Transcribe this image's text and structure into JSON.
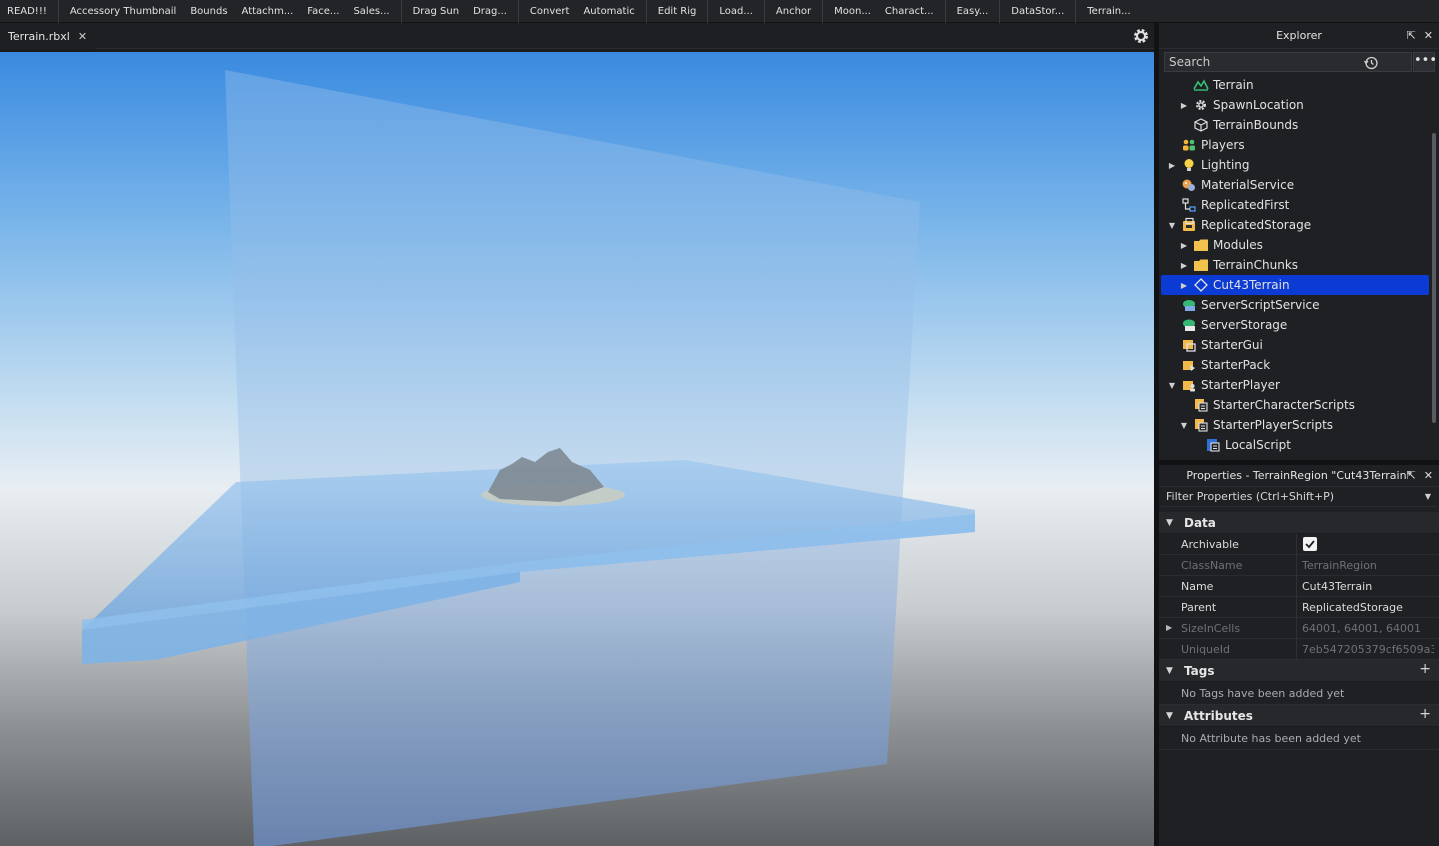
{
  "toolbar": {
    "buttons": [
      "READ!!!",
      "Accessory Thumbnail",
      "Bounds",
      "Attachm...",
      "Face...",
      "Sales...",
      "Drag Sun",
      "Drag...",
      "Convert",
      "Automatic",
      "Edit Rig",
      "Load...",
      "Anchor",
      "Moon...",
      "Charact...",
      "Easy...",
      "DataStor...",
      "Terrain..."
    ]
  },
  "tabs": [
    {
      "label": "Terrain.rbxl",
      "close_icon": "close-icon"
    }
  ],
  "explorer": {
    "title": "Explorer",
    "search_placeholder": "Search",
    "more_label": "•••",
    "items": [
      {
        "label": "Terrain",
        "depth": 1,
        "expander": "none",
        "icon": "terrain-icon"
      },
      {
        "label": "SpawnLocation",
        "depth": 1,
        "expander": "collapsed",
        "icon": "spawn-location-icon"
      },
      {
        "label": "TerrainBounds",
        "depth": 1,
        "expander": "none",
        "icon": "part-icon"
      },
      {
        "label": "Players",
        "depth": 0,
        "expander": "none",
        "icon": "players-icon"
      },
      {
        "label": "Lighting",
        "depth": 0,
        "expander": "collapsed",
        "icon": "lighting-icon"
      },
      {
        "label": "MaterialService",
        "depth": 0,
        "expander": "none",
        "icon": "material-service-icon"
      },
      {
        "label": "ReplicatedFirst",
        "depth": 0,
        "expander": "none",
        "icon": "replicated-first-icon"
      },
      {
        "label": "ReplicatedStorage",
        "depth": 0,
        "expander": "expanded",
        "icon": "replicated-storage-icon"
      },
      {
        "label": "Modules",
        "depth": 1,
        "expander": "collapsed",
        "icon": "folder-icon"
      },
      {
        "label": "TerrainChunks",
        "depth": 1,
        "expander": "collapsed",
        "icon": "folder-icon"
      },
      {
        "label": "Cut43Terrain",
        "depth": 1,
        "expander": "collapsed",
        "icon": "terrain-region-icon",
        "selected": true
      },
      {
        "label": "ServerScriptService",
        "depth": 0,
        "expander": "none",
        "icon": "server-script-service-icon"
      },
      {
        "label": "ServerStorage",
        "depth": 0,
        "expander": "none",
        "icon": "server-storage-icon"
      },
      {
        "label": "StarterGui",
        "depth": 0,
        "expander": "none",
        "icon": "starter-gui-icon"
      },
      {
        "label": "StarterPack",
        "depth": 0,
        "expander": "none",
        "icon": "starter-pack-icon"
      },
      {
        "label": "StarterPlayer",
        "depth": 0,
        "expander": "expanded",
        "icon": "starter-player-icon"
      },
      {
        "label": "StarterCharacterScripts",
        "depth": 1,
        "expander": "none",
        "icon": "starter-scripts-icon"
      },
      {
        "label": "StarterPlayerScripts",
        "depth": 1,
        "expander": "expanded",
        "icon": "starter-scripts-icon"
      },
      {
        "label": "LocalScript",
        "depth": 2,
        "expander": "none",
        "icon": "local-script-icon"
      }
    ]
  },
  "properties": {
    "title": "Properties - TerrainRegion \"Cut43Terrain\"",
    "filter_placeholder": "Filter Properties (Ctrl+Shift+P)",
    "sections": {
      "data": "Data",
      "tags": "Tags",
      "attributes": "Attributes"
    },
    "rows": [
      {
        "name": "Archivable",
        "value": "",
        "checkbox": true,
        "checked": true,
        "dim": false
      },
      {
        "name": "ClassName",
        "value": "TerrainRegion",
        "dim": true
      },
      {
        "name": "Name",
        "value": "Cut43Terrain",
        "dim": false
      },
      {
        "name": "Parent",
        "value": "ReplicatedStorage",
        "dim": false
      },
      {
        "name": "SizeInCells",
        "value": "64001, 64001, 64001",
        "dim": true,
        "expandable": true
      },
      {
        "name": "UniqueId",
        "value": "7eb547205379cf6509a3...",
        "dim": true
      }
    ],
    "tags_empty": "No Tags have been added yet",
    "attributes_empty": "No Attribute has been added yet"
  },
  "colors": {
    "selection": "#0b3ad4",
    "panel_bg": "#1f2023",
    "sky_top": "#3a8ae0"
  }
}
